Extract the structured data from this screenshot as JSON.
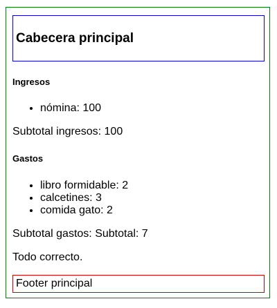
{
  "header": {
    "title": "Cabecera principal"
  },
  "ingresos": {
    "title": "Ingresos",
    "items": [
      "nómina: 100"
    ],
    "subtotal": "Subtotal ingresos: 100"
  },
  "gastos": {
    "title": "Gastos",
    "items": [
      "libro formidable: 2",
      "calcetines: 3",
      "comida gato: 2"
    ],
    "subtotal": "Subtotal gastos: Subtotal: 7"
  },
  "status": "Todo correcto.",
  "footer": {
    "text": "Footer principal"
  },
  "colors": {
    "app_border": "#008000",
    "header_border": "#0000cc",
    "footer_border": "#cc0000"
  }
}
